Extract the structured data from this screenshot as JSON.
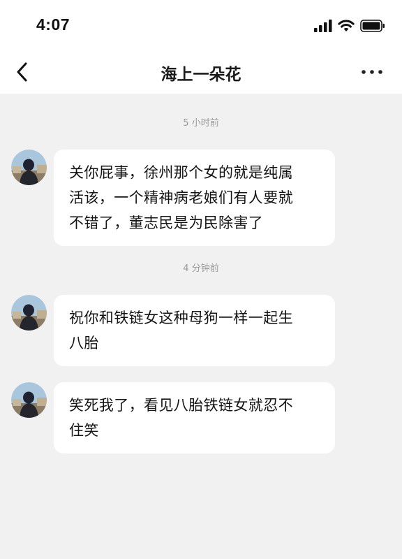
{
  "status_bar": {
    "time": "4:07",
    "icons": [
      "cellular-signal-icon",
      "wifi-icon",
      "battery-icon"
    ]
  },
  "header": {
    "title": "海上一朵花",
    "back_icon": "chevron-left-icon",
    "more_icon": "more-dots-icon"
  },
  "messages": [
    {
      "divider": "5 小时前",
      "lines": [
        "关你屁事，徐州那个女的就是纯属",
        "活该，一个精神病老娘们有人要就",
        "不错了，董志民是为民除害了"
      ]
    },
    {
      "divider": "4 分钟前",
      "lines": [
        "祝你和铁链女这种母狗一样一起生",
        "八胎"
      ]
    },
    {
      "lines": [
        "笑死我了，看见八胎铁链女就忍不",
        "住笑"
      ]
    }
  ],
  "colors": {
    "background": "#f1f1f1",
    "bubble": "#ffffff",
    "header": "#ffffff",
    "timestamp": "#9a9a9a"
  }
}
